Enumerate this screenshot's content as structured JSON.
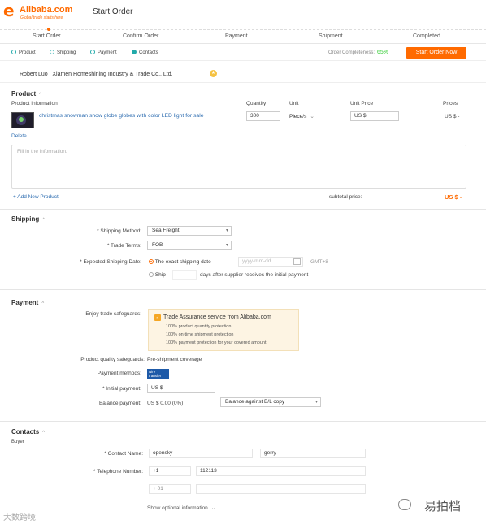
{
  "header": {
    "logo_text": "Alibaba.com",
    "logo_sub": "Global trade starts here.",
    "title": "Start Order"
  },
  "steps": [
    {
      "label": "Start Order"
    },
    {
      "label": "Confirm Order"
    },
    {
      "label": "Payment"
    },
    {
      "label": "Shipment"
    },
    {
      "label": "Completed"
    }
  ],
  "tabs": [
    {
      "label": "Product"
    },
    {
      "label": "Shipping"
    },
    {
      "label": "Payment"
    },
    {
      "label": "Contacts"
    }
  ],
  "completeness": {
    "label": "Order Completeness:",
    "value": "65%"
  },
  "start_order_button": "Start Order Now",
  "supplier": {
    "text": "Robert Luo  |  Xiamen Homeshining Industry & Trade Co., Ltd."
  },
  "product": {
    "title": "Product",
    "columns": {
      "info": "Product Information",
      "quantity": "Quantity",
      "unit": "Unit",
      "unit_price": "Unit Price",
      "prices": "Prices"
    },
    "item": {
      "name": "christmas snowman snow globe globes with color LED light for sale",
      "quantity": "300",
      "unit": "Piece/s",
      "unit_price": "US $",
      "price": "US $ -"
    },
    "delete_label": "Delete",
    "notes_placeholder": "Fill in the information.",
    "add_label": "+ Add New Product",
    "subtotal_label": "subtotal price:",
    "subtotal_value": "US $ -"
  },
  "shipping": {
    "title": "Shipping",
    "method_label": "* Shipping Method:",
    "method_value": "Sea Freight",
    "terms_label": "* Trade Terms:",
    "terms_value": "FOB",
    "date_label": "* Expected Shipping Date:",
    "exact_label": "The exact shipping date",
    "date_placeholder": "yyyy-mm-dd",
    "timezone": "GMT+8",
    "ship_label": "Ship",
    "ship_after": "days after supplier receives the initial payment"
  },
  "payment": {
    "title": "Payment",
    "safeguards_label": "Enjoy trade safeguards:",
    "ta_title": "Trade Assurance service from Alibaba.com",
    "ta_lines": [
      "100% product quantity protection",
      "100% on-time shipment protection",
      "100% payment protection for your covered amount"
    ],
    "quality_label": "Product quality safeguards:",
    "quality_value": "Pre-shipment coverage",
    "methods_label": "Payment methods:",
    "method_logo": "wire transfer",
    "initial_label": "* Initial payment:",
    "initial_value": "US $",
    "balance_label": "Balance payment:",
    "balance_value": "US $ 0.00 (0%)",
    "balance_select": "Balance against B/L copy"
  },
  "contacts": {
    "title": "Contacts",
    "subtitle": "Buyer",
    "name_label": "* Contact Name:",
    "first_name": "opensky",
    "last_name": "gerry",
    "phone_label": "* Telephone Number:",
    "country_code": "+1",
    "phone": "112113",
    "fax_code": "+ 01",
    "optional_label": "Show optional information"
  },
  "watermarks": {
    "left": "大数跨境",
    "right": "易拍档"
  }
}
